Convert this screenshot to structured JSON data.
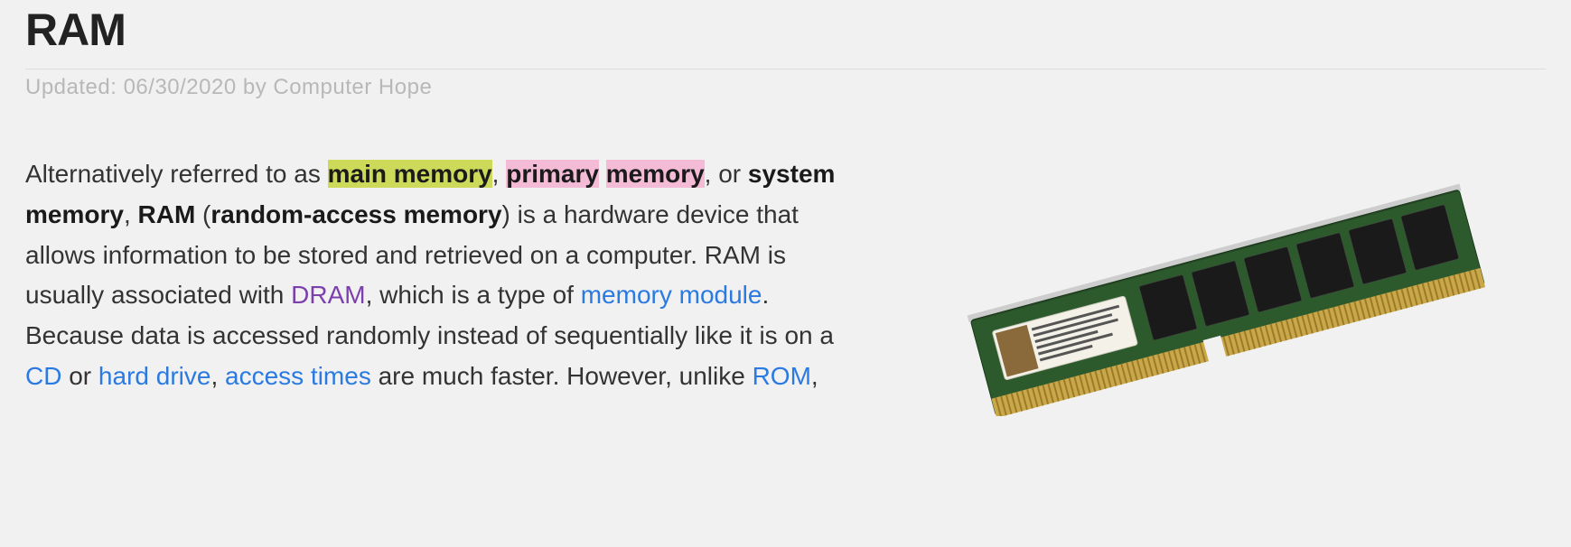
{
  "title": "RAM",
  "meta": "Updated: 06/30/2020 by Computer Hope",
  "text": {
    "t0": "Alternatively referred to as ",
    "hl_main": "main memory",
    "t1": ", ",
    "hl_primary_a": "primary",
    "hl_primary_b": "memory",
    "t2": ", or ",
    "b_sysmem": "system memory",
    "t3": ", ",
    "b_ram": "RAM",
    "t4": " (",
    "b_random": "random-access memory",
    "t5": ") is a hardware device that allows information to be stored and retrieved on a computer. RAM is usually associated with ",
    "link_dram": "DRAM",
    "t6": ", which is a type of ",
    "link_memmod": "memory module",
    "t7": ". Because data is accessed randomly instead of sequentially like it is on a ",
    "link_cd": "CD",
    "t8": " or ",
    "link_hdd": "hard drive",
    "t9": ", ",
    "link_access": "access times",
    "t10": " are much faster. However, unlike ",
    "link_rom": "ROM",
    "t11": ","
  }
}
